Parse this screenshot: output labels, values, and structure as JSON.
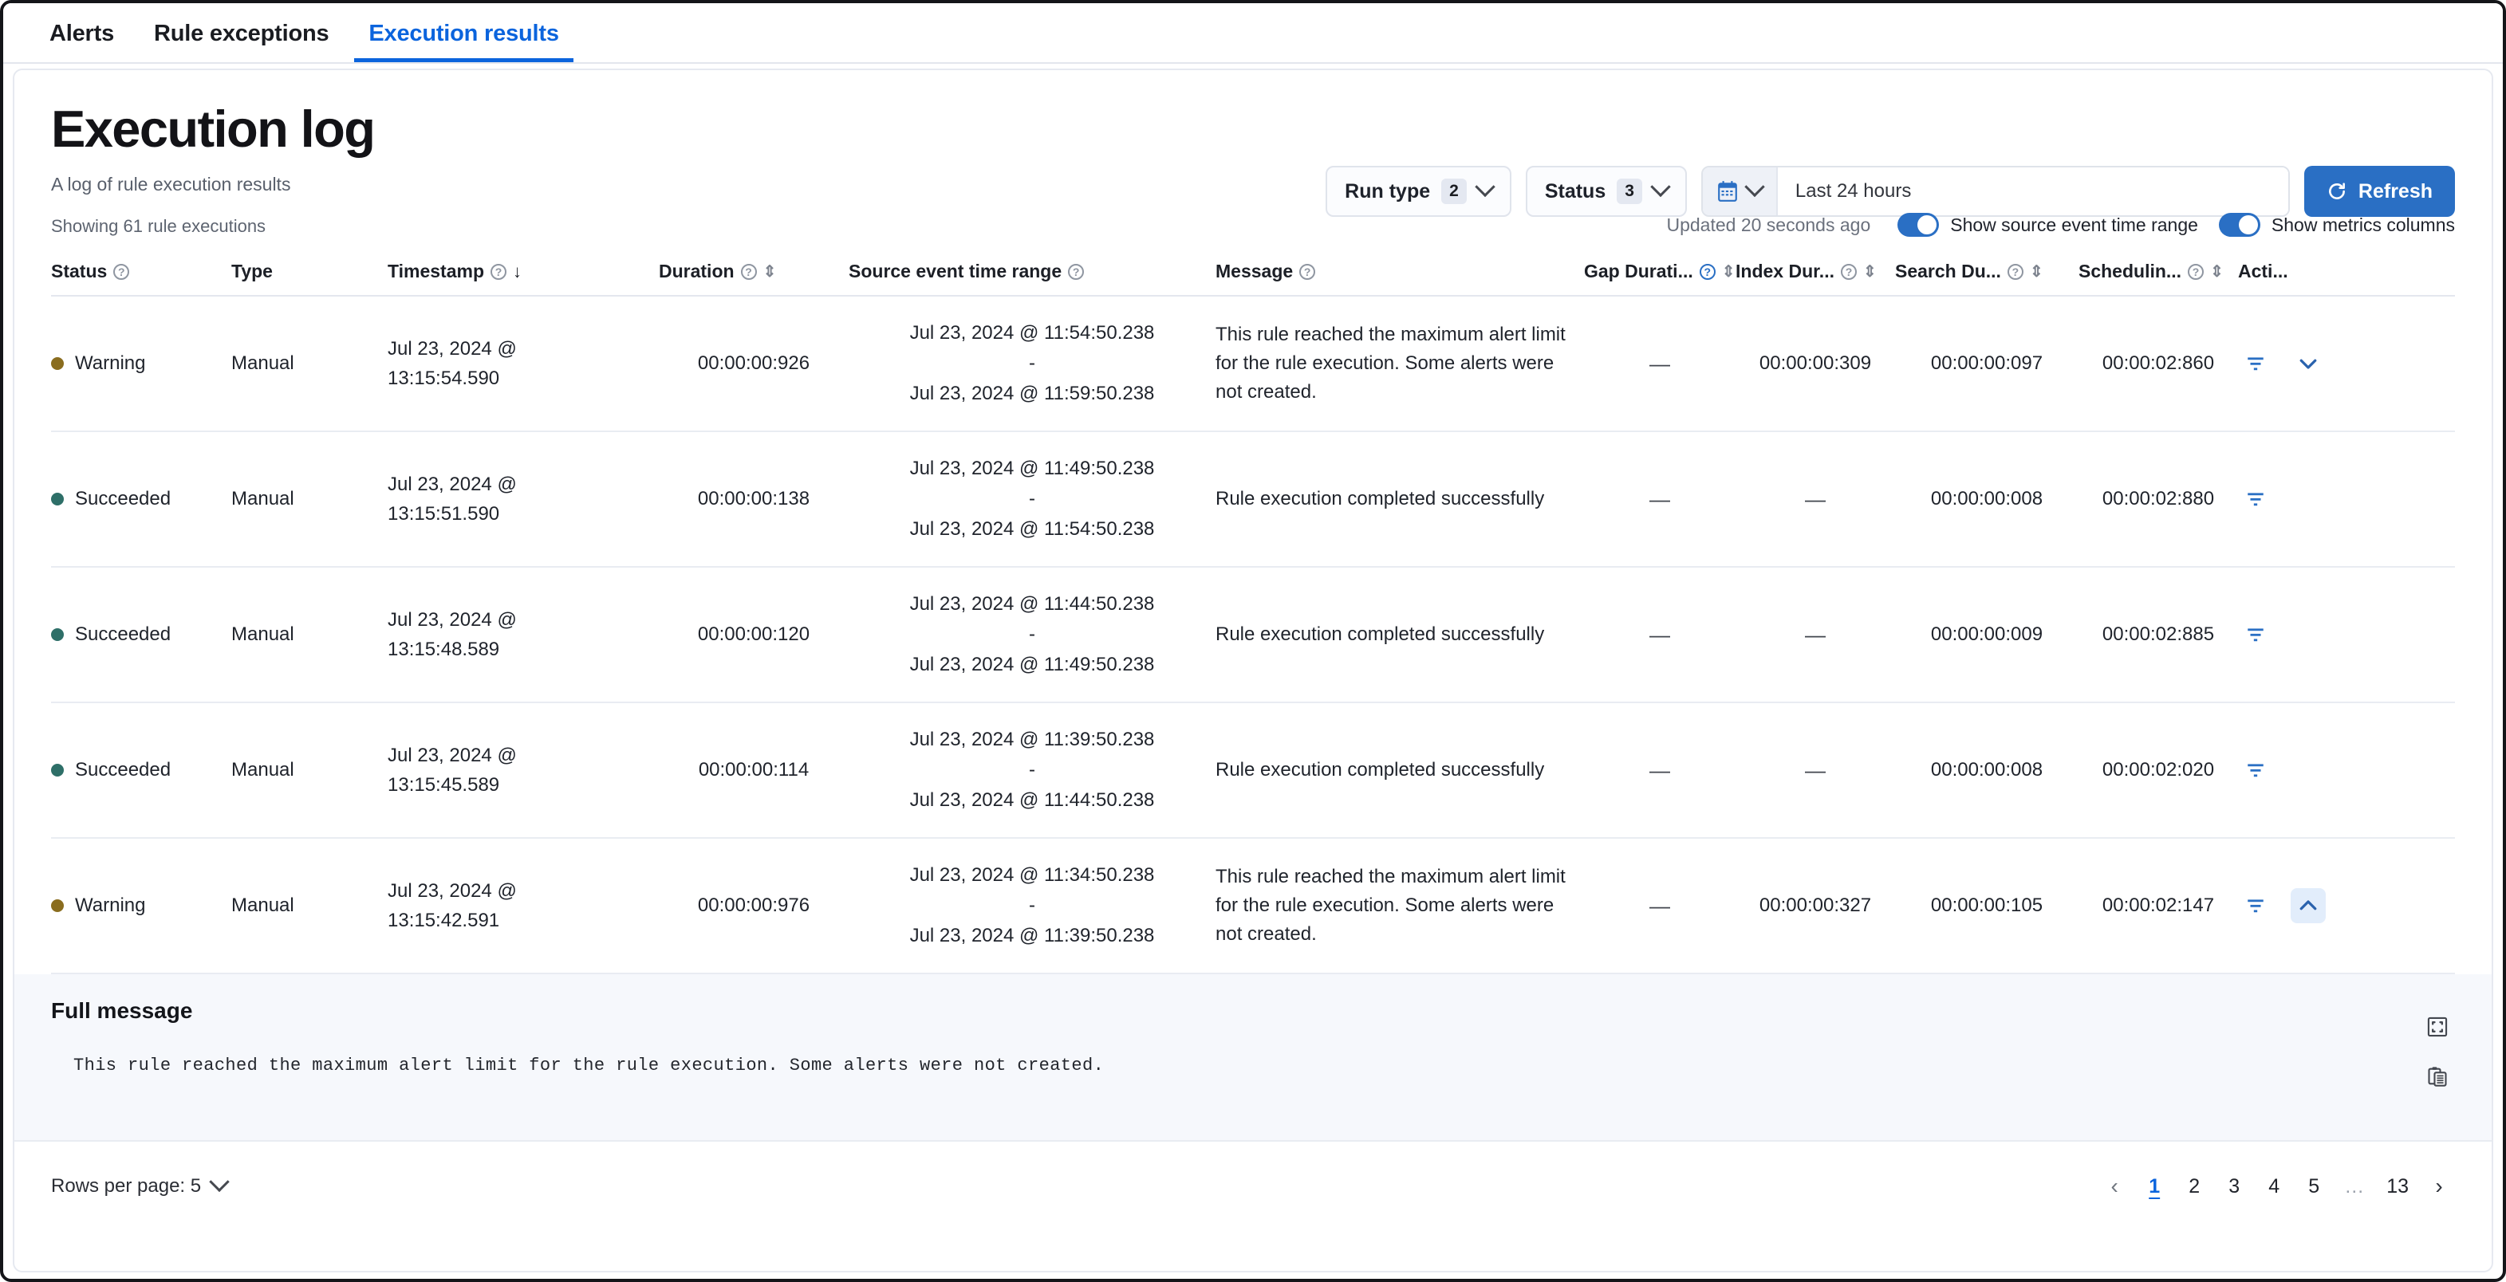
{
  "tabs": [
    {
      "label": "Alerts",
      "active": false
    },
    {
      "label": "Rule exceptions",
      "active": false
    },
    {
      "label": "Execution results",
      "active": true
    }
  ],
  "header": {
    "title": "Execution log",
    "subtitle": "A log of rule execution results"
  },
  "toolbar": {
    "run_type": {
      "label": "Run type",
      "count": "2"
    },
    "status": {
      "label": "Status",
      "count": "3"
    },
    "date_range_value": "Last 24 hours",
    "date_range_placeholder": "Last 24 hours",
    "refresh_label": "Refresh"
  },
  "table_meta": {
    "showing": "Showing 61 rule executions",
    "updated": "Updated 20 seconds ago",
    "toggle_source_event": {
      "label": "Show source event time range",
      "on": true
    },
    "toggle_metrics": {
      "label": "Show metrics columns",
      "on": true
    }
  },
  "columns": [
    {
      "label": "Status",
      "help": true,
      "sort": "none"
    },
    {
      "label": "Type",
      "help": false,
      "sort": "none"
    },
    {
      "label": "Timestamp",
      "help": true,
      "sort": "desc"
    },
    {
      "label": "Duration",
      "help": true,
      "sort": "both"
    },
    {
      "label": "Source event time range",
      "help": true,
      "sort": "none"
    },
    {
      "label": "Message",
      "help": true,
      "sort": "none"
    },
    {
      "label": "Gap Durati...",
      "help": true,
      "sort": "both"
    },
    {
      "label": "Index Dur...",
      "help": true,
      "sort": "both"
    },
    {
      "label": "Search Du...",
      "help": true,
      "sort": "both"
    },
    {
      "label": "Schedulin...",
      "help": true,
      "sort": "both"
    },
    {
      "label": "Acti...",
      "help": false,
      "sort": "none"
    }
  ],
  "rows": [
    {
      "status": "Warning",
      "status_kind": "warning",
      "type": "Manual",
      "timestamp_date": "Jul 23, 2024 @",
      "timestamp_time": "13:15:54.590",
      "duration": "00:00:00:926",
      "source_start": "Jul 23, 2024 @ 11:54:50.238",
      "source_sep": "-",
      "source_end": "Jul 23, 2024 @ 11:59:50.238",
      "message": "This rule reached the maximum alert limit for the rule execution. Some alerts were not created.",
      "gap_duration": "—",
      "index_duration": "00:00:00:309",
      "search_duration": "00:00:00:097",
      "scheduling_duration": "00:00:02:860",
      "has_expand": true,
      "expanded": false
    },
    {
      "status": "Succeeded",
      "status_kind": "succeeded",
      "type": "Manual",
      "timestamp_date": "Jul 23, 2024 @",
      "timestamp_time": "13:15:51.590",
      "duration": "00:00:00:138",
      "source_start": "Jul 23, 2024 @ 11:49:50.238",
      "source_sep": "-",
      "source_end": "Jul 23, 2024 @ 11:54:50.238",
      "message": "Rule execution completed successfully",
      "gap_duration": "—",
      "index_duration": "—",
      "search_duration": "00:00:00:008",
      "scheduling_duration": "00:00:02:880",
      "has_expand": false,
      "expanded": false
    },
    {
      "status": "Succeeded",
      "status_kind": "succeeded",
      "type": "Manual",
      "timestamp_date": "Jul 23, 2024 @",
      "timestamp_time": "13:15:48.589",
      "duration": "00:00:00:120",
      "source_start": "Jul 23, 2024 @ 11:44:50.238",
      "source_sep": "-",
      "source_end": "Jul 23, 2024 @ 11:49:50.238",
      "message": "Rule execution completed successfully",
      "gap_duration": "—",
      "index_duration": "—",
      "search_duration": "00:00:00:009",
      "scheduling_duration": "00:00:02:885",
      "has_expand": false,
      "expanded": false
    },
    {
      "status": "Succeeded",
      "status_kind": "succeeded",
      "type": "Manual",
      "timestamp_date": "Jul 23, 2024 @",
      "timestamp_time": "13:15:45.589",
      "duration": "00:00:00:114",
      "source_start": "Jul 23, 2024 @ 11:39:50.238",
      "source_sep": "-",
      "source_end": "Jul 23, 2024 @ 11:44:50.238",
      "message": "Rule execution completed successfully",
      "gap_duration": "—",
      "index_duration": "—",
      "search_duration": "00:00:00:008",
      "scheduling_duration": "00:00:02:020",
      "has_expand": false,
      "expanded": false
    },
    {
      "status": "Warning",
      "status_kind": "warning",
      "type": "Manual",
      "timestamp_date": "Jul 23, 2024 @",
      "timestamp_time": "13:15:42.591",
      "duration": "00:00:00:976",
      "source_start": "Jul 23, 2024 @ 11:34:50.238",
      "source_sep": "-",
      "source_end": "Jul 23, 2024 @ 11:39:50.238",
      "message": "This rule reached the maximum alert limit for the rule execution. Some alerts were not created.",
      "gap_duration": "—",
      "index_duration": "00:00:00:327",
      "search_duration": "00:00:00:105",
      "scheduling_duration": "00:00:02:147",
      "has_expand": true,
      "expanded": true
    }
  ],
  "full_message": {
    "title": "Full message",
    "body": "This rule reached the maximum alert limit for the rule execution. Some alerts were not created."
  },
  "footer": {
    "rows_per_page_label": "Rows per page: 5",
    "pages": [
      "1",
      "2",
      "3",
      "4",
      "5",
      "…",
      "13"
    ],
    "current_page": "1"
  },
  "colors": {
    "accent": "#0b64dd",
    "primary_button": "#2a6fc4",
    "warning_dot": "#8a6d1f",
    "succeeded_dot": "#2e6f68"
  }
}
